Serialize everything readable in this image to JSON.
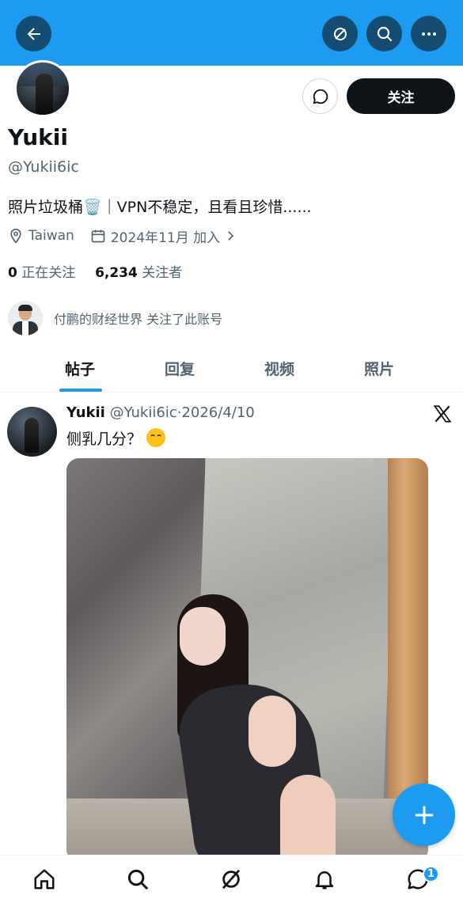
{
  "header": {
    "back_icon": "arrow-left-icon",
    "icons": [
      "grok-icon",
      "search-icon",
      "more-icon"
    ]
  },
  "profile": {
    "name": "Yukii",
    "handle": "@Yukii6ic",
    "bio": "照片垃圾桶🗑️｜VPN不稳定，且看且珍惜......",
    "location": "Taiwan",
    "joined": "2024年11月 加入",
    "following_count": "0",
    "following_label": "正在关注",
    "followers_count": "6,234",
    "followers_label": "关注者",
    "follow_button": "关注",
    "followed_by": "付鹏的财经世界 关注了此账号"
  },
  "tabs": [
    {
      "label": "帖子",
      "active": true
    },
    {
      "label": "回复",
      "active": false
    },
    {
      "label": "视频",
      "active": false
    },
    {
      "label": "照片",
      "active": false
    }
  ],
  "post": {
    "author": "Yukii",
    "handle": "@Yukii6ic",
    "separator": "·",
    "date": "2026/4/10",
    "text": "侧乳几分？"
  },
  "bottom_nav": {
    "icons": [
      "home-icon",
      "search-icon",
      "grok-icon",
      "notifications-icon",
      "messages-icon"
    ],
    "messages_badge": "1"
  },
  "colors": {
    "header_blue": "#1d9bf0",
    "header_button": "#154d72",
    "follow_button": "#0f1419",
    "secondary_text": "#536471"
  }
}
